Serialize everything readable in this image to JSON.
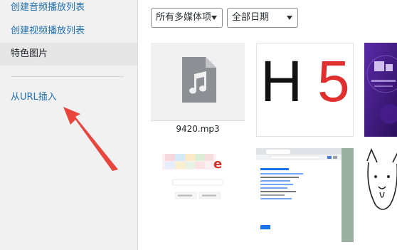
{
  "sidebar": {
    "items": [
      {
        "label": "创建音频播放列表"
      },
      {
        "label": "创建视频播放列表"
      },
      {
        "label": "特色图片"
      },
      {
        "label": "从URL插入"
      }
    ]
  },
  "toolbar": {
    "type_filter": "所有多媒体项",
    "date_filter": "全部日期"
  },
  "media": {
    "audio_filename": "9420.mp3",
    "h5_text": [
      "H",
      "5"
    ]
  },
  "colors": {
    "accent_link": "#2271b1",
    "annotation_arrow": "#e8453c",
    "audio_icon": "#8c8f94",
    "h5_red": "#e02f2f"
  },
  "icons": {
    "audio": "music-note-file-icon",
    "caret": "chevron-down-icon"
  }
}
